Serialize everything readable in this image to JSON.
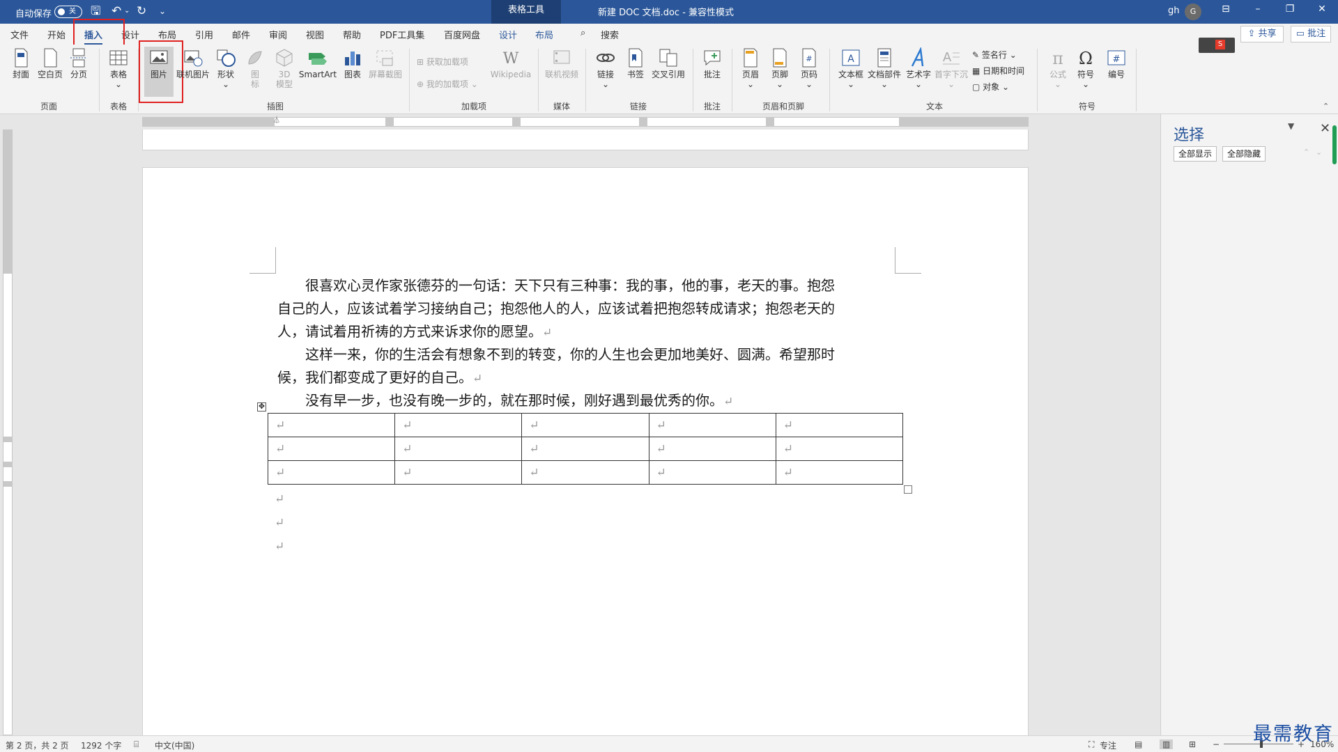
{
  "titlebar": {
    "autosave_label": "自动保存",
    "autosave_state": "关",
    "context_tab": "表格工具",
    "doc_title": "新建 DOC 文档.doc  -  兼容性模式",
    "user_name": "gh",
    "avatar_initial": "G"
  },
  "tabs": [
    {
      "label": "文件"
    },
    {
      "label": "开始"
    },
    {
      "label": "插入"
    },
    {
      "label": "设计"
    },
    {
      "label": "布局"
    },
    {
      "label": "引用"
    },
    {
      "label": "邮件"
    },
    {
      "label": "审阅"
    },
    {
      "label": "视图"
    },
    {
      "label": "帮助"
    },
    {
      "label": "PDF工具集"
    },
    {
      "label": "百度网盘"
    },
    {
      "label": "设计"
    },
    {
      "label": "布局"
    }
  ],
  "search_label": "搜索",
  "share_label": "共享",
  "comment_label": "批注",
  "ribbon": {
    "cover": "封面",
    "blank_page": "空白页",
    "page_break": "分页",
    "table": "表格",
    "picture": "图片",
    "online_picture": "联机图片",
    "shapes": "形状",
    "icons_1": "图",
    "icons_2": "标",
    "model3d_1": "3D",
    "model3d_2": "模型",
    "smartart": "SmartArt",
    "chart": "图表",
    "screenshot": "屏幕截图",
    "get_addins": "获取加载项",
    "my_addins": "我的加载项",
    "wikipedia": "Wikipedia",
    "online_video": "联机视频",
    "link": "链接",
    "bookmark": "书签",
    "cross_ref": "交叉引用",
    "comment": "批注",
    "header": "页眉",
    "footer": "页脚",
    "page_number": "页码",
    "textbox": "文本框",
    "quick_parts": "文档部件",
    "wordart": "艺术字",
    "dropcap": "首字下沉",
    "signature": "签名行",
    "datetime": "日期和时间",
    "object": "对象",
    "equation": "公式",
    "symbol": "符号",
    "number": "编号",
    "groups": {
      "pages": "页面",
      "tables": "表格",
      "illustrations": "插图",
      "addins": "加载项",
      "media": "媒体",
      "links": "链接",
      "comments": "批注",
      "header_footer": "页眉和页脚",
      "text": "文本",
      "symbols": "符号"
    }
  },
  "document": {
    "paragraphs": [
      {
        "lines": [
          "　　很喜欢心灵作家张德芬的一句话：天下只有三种事：我的事，他的事，老天的事。抱怨",
          "自己的人，应该试着学习接纳自己；抱怨他人的人，应该试着把抱怨转成请求；抱怨老天的",
          "人，请试着用祈祷的方式来诉求你的愿望。"
        ]
      },
      {
        "lines": [
          "　　这样一来，你的生活会有想象不到的转变，你的人生也会更加地美好、圆满。希望那时",
          "候，我们都变成了更好的自己。"
        ]
      },
      {
        "lines": [
          "　　没有早一步，也没有晚一步的，就在那时候，刚好遇到最优秀的你。"
        ]
      }
    ],
    "paragraph_mark": "↵",
    "table_rows": 3,
    "table_cols": 5
  },
  "pane": {
    "title": "选择",
    "show_all": "全部显示",
    "hide_all": "全部隐藏"
  },
  "status": {
    "page": "第 2 页，共 2 页",
    "words": "1292 个字",
    "language": "中文(中国)",
    "focus": "专注",
    "zoom": "160%"
  },
  "watermark": "最需教育"
}
